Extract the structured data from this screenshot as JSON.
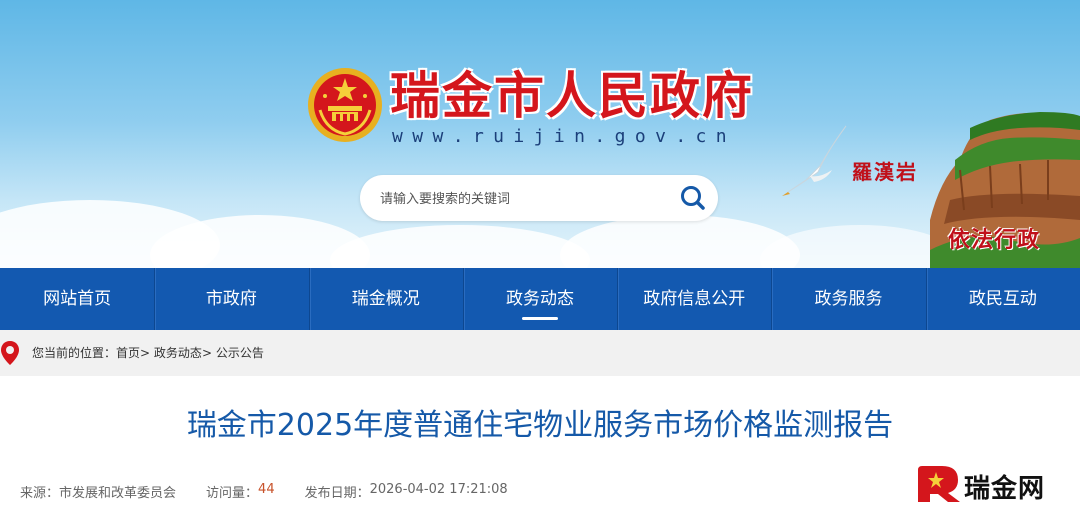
{
  "header": {
    "site_title": "瑞金市人民政府",
    "site_url": "www.ruijin.gov.cn",
    "search_placeholder": "请输入要搜索的关键词",
    "banner_tag_rock": "羅漢岩",
    "banner_tag_law": "依法行政",
    "emblem_icon": "national-emblem-icon",
    "search_icon": "search-icon"
  },
  "nav": {
    "items": [
      {
        "label": "网站首页"
      },
      {
        "label": "市政府"
      },
      {
        "label": "瑞金概况"
      },
      {
        "label": "政务动态",
        "active": true
      },
      {
        "label": "政府信息公开"
      },
      {
        "label": "政务服务"
      },
      {
        "label": "政民互动"
      }
    ]
  },
  "breadcrumb": {
    "prefix": "您当前的位置：",
    "items": [
      "首页",
      "政务动态",
      "公示公告"
    ],
    "separator": ">",
    "icon": "location-pin-icon"
  },
  "article": {
    "title": "瑞金市2025年度普通住宅物业服务市场价格监测报告",
    "source_label": "来源：",
    "source": "市发展和改革委员会",
    "views_label": "访问量：",
    "views": "44",
    "date_label": "发布日期：",
    "date": "2026-04-02 17:21:08"
  },
  "watermark": {
    "text": "瑞金网"
  },
  "colors": {
    "nav_bg": "#1359b0",
    "title_red": "#d4161c",
    "article_title_blue": "#1559a8",
    "accent_orange": "#c7522a"
  }
}
